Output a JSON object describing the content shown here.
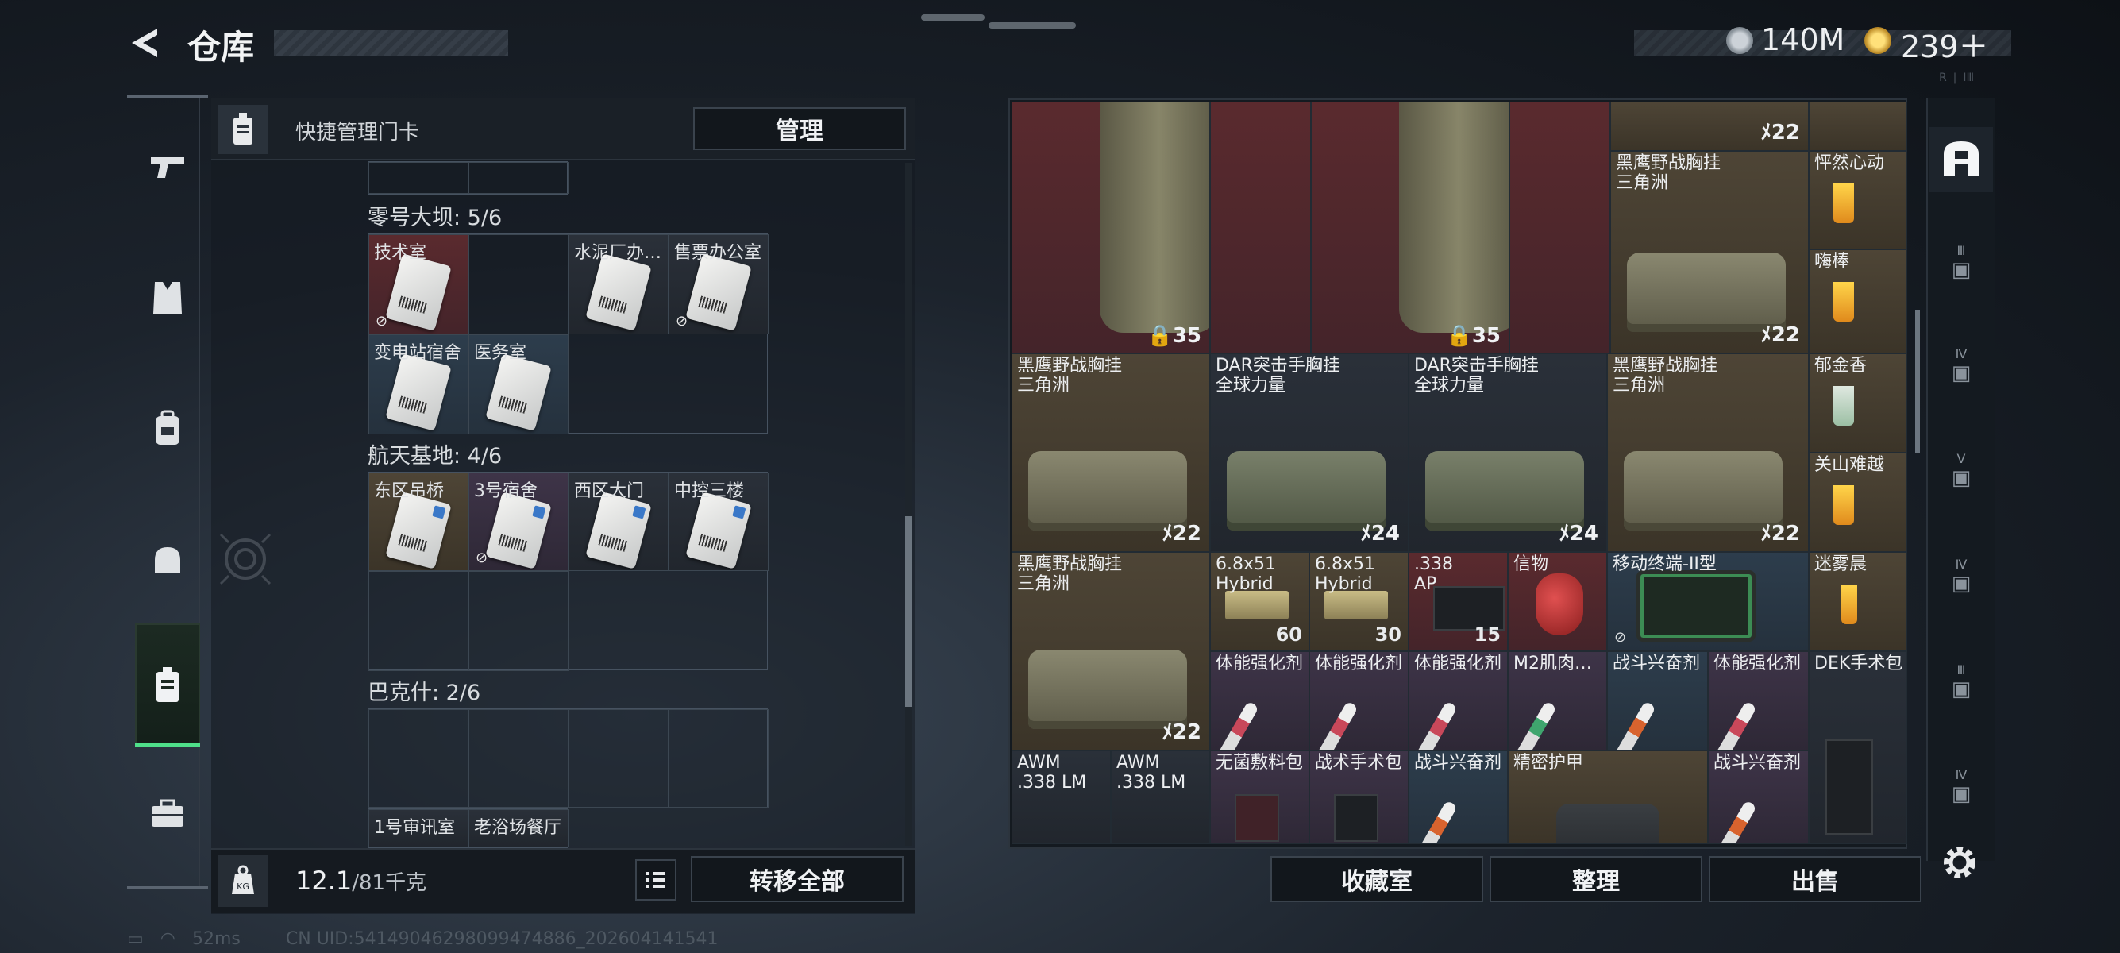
{
  "header": {
    "title": "仓库",
    "currency_silver": "140M",
    "currency_gold": "239＋"
  },
  "corner_mark": "R ❘ ⅠⅢ",
  "keycards": {
    "header_label": "快捷管理门卡",
    "manage_label": "管理",
    "sections": [
      {
        "title": "零号大坝: 5/6",
        "cards": [
          "技术室",
          "",
          "水泥厂办…",
          "售票办公室",
          "变电站宿舍",
          "医务室"
        ]
      },
      {
        "title": "航天基地: 4/6",
        "cards": [
          "东区吊桥",
          "3号宿舍",
          "西区大门",
          "中控三楼"
        ]
      },
      {
        "title": "巴克什: 2/6",
        "cards": [
          "1号审讯室",
          "老浴场餐厅"
        ]
      }
    ]
  },
  "footer": {
    "weight": "12.1",
    "weight_max": "/81千克",
    "transfer_label": "转移全部"
  },
  "status": {
    "ping": "52ms",
    "uid": "CN UID:5414904629809947488​6_202604141541"
  },
  "items": [
    {
      "name": "",
      "count": "35"
    },
    {
      "name": "",
      "count": "35"
    },
    {
      "name": "",
      "count": "22"
    },
    {
      "name": "黑鹰野战胸挂\n三角洲",
      "count": "22"
    },
    {
      "name": "怦然心动",
      "count": ""
    },
    {
      "name": "嗨棒",
      "count": ""
    },
    {
      "name": "黑鹰野战胸挂\n三角洲",
      "count": "22"
    },
    {
      "name": "DAR突击手胸挂\n全球力量",
      "count": "24"
    },
    {
      "name": "DAR突击手胸挂\n全球力量",
      "count": "24"
    },
    {
      "name": "黑鹰野战胸挂\n三角洲",
      "count": "22"
    },
    {
      "name": "郁金香",
      "count": ""
    },
    {
      "name": "关山难越",
      "count": ""
    },
    {
      "name": "黑鹰野战胸挂\n三角洲",
      "count": "22"
    },
    {
      "name": "6.8x51\nHybrid",
      "count": "60"
    },
    {
      "name": "6.8x51\nHybrid",
      "count": "30"
    },
    {
      "name": ".338\nAP",
      "count": "15"
    },
    {
      "name": "信物",
      "count": ""
    },
    {
      "name": "移动终端-II型",
      "count": ""
    },
    {
      "name": "迷雾晨",
      "count": ""
    },
    {
      "name": "体能强化剂",
      "count": ""
    },
    {
      "name": "体能强化剂",
      "count": ""
    },
    {
      "name": "体能强化剂",
      "count": ""
    },
    {
      "name": "M2肌肉…",
      "count": ""
    },
    {
      "name": "战斗兴奋剂",
      "count": ""
    },
    {
      "name": "体能强化剂",
      "count": ""
    },
    {
      "name": "DEK手术包",
      "count": ""
    },
    {
      "name": "AWM\n.338 LM",
      "count": ""
    },
    {
      "name": "AWM\n.338 LM",
      "count": ""
    },
    {
      "name": "无菌敷料包",
      "count": ""
    },
    {
      "name": "战术手术包",
      "count": ""
    },
    {
      "name": "战斗兴奋剂",
      "count": ""
    },
    {
      "name": "精密护甲",
      "count": ""
    },
    {
      "name": "战斗兴奋剂",
      "count": ""
    }
  ],
  "actions": {
    "collection": "收藏室",
    "organize": "整理",
    "sell": "出售"
  },
  "tabs": [
    "Ⅲ",
    "Ⅳ",
    "Ⅴ",
    "Ⅳ",
    "Ⅲ",
    "Ⅳ"
  ]
}
